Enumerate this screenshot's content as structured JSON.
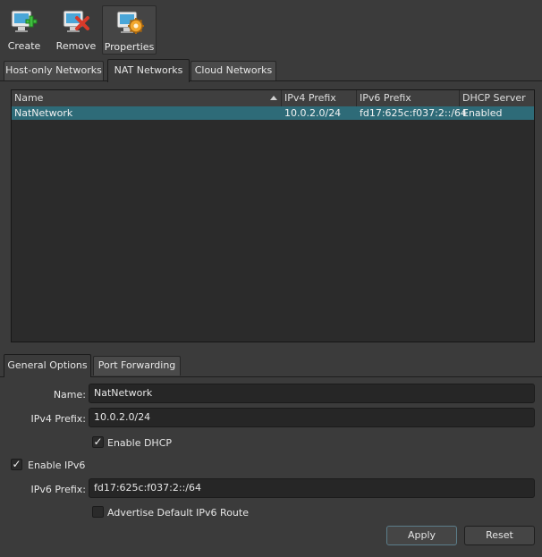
{
  "toolbar": {
    "create_label": "Create",
    "remove_label": "Remove",
    "properties_label": "Properties"
  },
  "tabs": [
    "Host-only Networks",
    "NAT Networks",
    "Cloud Networks"
  ],
  "table": {
    "columns": [
      "Name",
      "IPv4 Prefix",
      "IPv6 Prefix",
      "DHCP Server"
    ],
    "rows": [
      [
        "NatNetwork",
        "10.0.2.0/24",
        "fd17:625c:f037:2::/64",
        "Enabled"
      ]
    ]
  },
  "subtabs": [
    "General Options",
    "Port Forwarding"
  ],
  "form": {
    "name_label": "Name:",
    "name_value": "NatNetwork",
    "ipv4_label": "IPv4 Prefix:",
    "ipv4_value": "10.0.2.0/24",
    "enable_dhcp_label": "Enable DHCP",
    "enable_dhcp_checked": true,
    "enable_ipv6_label": "Enable IPv6",
    "enable_ipv6_checked": true,
    "ipv6_label": "IPv6 Prefix:",
    "ipv6_value": "fd17:625c:f037:2::/64",
    "advertise_label": "Advertise Default IPv6 Route",
    "advertise_checked": false
  },
  "buttons": {
    "apply": "Apply",
    "reset": "Reset"
  },
  "check_glyph": "✓",
  "colors": {
    "selection": "#2e6b78",
    "background": "#3b3b3b"
  }
}
